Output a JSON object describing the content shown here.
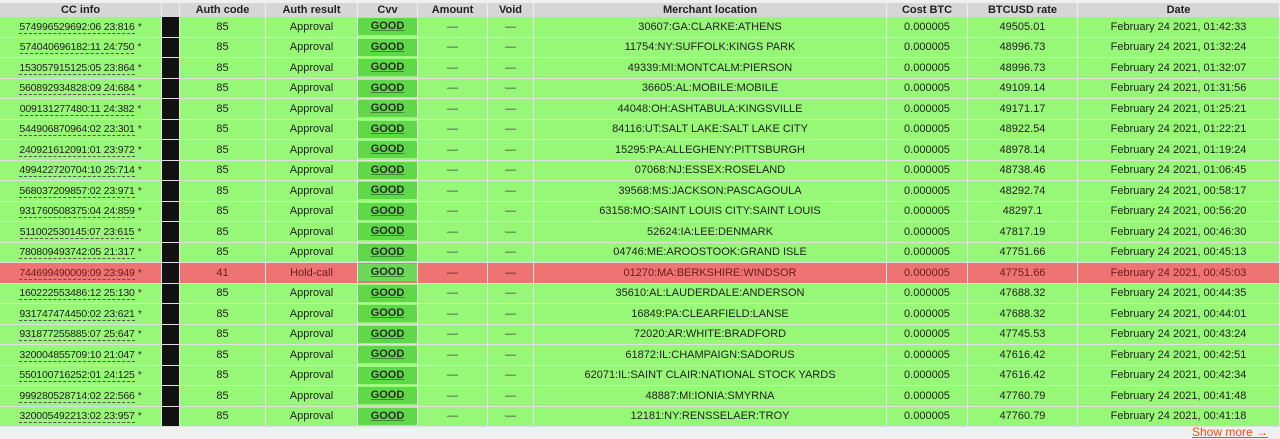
{
  "headers": [
    "CC info",
    "",
    "Auth code",
    "Auth result",
    "Cvv",
    "Amount",
    "Void",
    "Merchant location",
    "Cost BTC",
    "BTCUSD rate",
    "Date"
  ],
  "show_more": "Show more →",
  "colors": {
    "row_ok": "#97f776",
    "row_hold": "#ee7373",
    "cvv_good": "#5fd84a",
    "link": "#e8501e"
  },
  "rows": [
    {
      "cc": "574996529692:06 23:816",
      "auth_code": "85",
      "auth_result": "Approval",
      "cvv": "GOOD",
      "amount": "—",
      "void": "—",
      "location": "30607:GA:CLARKE:ATHENS",
      "cost_btc": "0.000005",
      "btcusd": "49505.01",
      "date": "February 24 2021, 01:42:33",
      "status": "ok"
    },
    {
      "cc": "574040696182:11 24:750",
      "auth_code": "85",
      "auth_result": "Approval",
      "cvv": "GOOD",
      "amount": "—",
      "void": "—",
      "location": "11754:NY:SUFFOLK:KINGS PARK",
      "cost_btc": "0.000005",
      "btcusd": "48996.73",
      "date": "February 24 2021, 01:32:24",
      "status": "ok"
    },
    {
      "cc": "153057915125:05 23:864",
      "auth_code": "85",
      "auth_result": "Approval",
      "cvv": "GOOD",
      "amount": "—",
      "void": "—",
      "location": "49339:MI:MONTCALM:PIERSON",
      "cost_btc": "0.000005",
      "btcusd": "48996.73",
      "date": "February 24 2021, 01:32:07",
      "status": "ok"
    },
    {
      "cc": "560892934828:09 24:684",
      "auth_code": "85",
      "auth_result": "Approval",
      "cvv": "GOOD",
      "amount": "—",
      "void": "—",
      "location": "36605:AL:MOBILE:MOBILE",
      "cost_btc": "0.000005",
      "btcusd": "49109.14",
      "date": "February 24 2021, 01:31:56",
      "status": "ok"
    },
    {
      "cc": "009131277480:11 24:382",
      "auth_code": "85",
      "auth_result": "Approval",
      "cvv": "GOOD",
      "amount": "—",
      "void": "—",
      "location": "44048:OH:ASHTABULA:KINGSVILLE",
      "cost_btc": "0.000005",
      "btcusd": "49171.17",
      "date": "February 24 2021, 01:25:21",
      "status": "ok"
    },
    {
      "cc": "544906870964:02 23:301",
      "auth_code": "85",
      "auth_result": "Approval",
      "cvv": "GOOD",
      "amount": "—",
      "void": "—",
      "location": "84116:UT:SALT LAKE:SALT LAKE CITY",
      "cost_btc": "0.000005",
      "btcusd": "48922.54",
      "date": "February 24 2021, 01:22:21",
      "status": "ok"
    },
    {
      "cc": "240921612091:01 23:972",
      "auth_code": "85",
      "auth_result": "Approval",
      "cvv": "GOOD",
      "amount": "—",
      "void": "—",
      "location": "15295:PA:ALLEGHENY:PITTSBURGH",
      "cost_btc": "0.000005",
      "btcusd": "48978.14",
      "date": "February 24 2021, 01:19:24",
      "status": "ok"
    },
    {
      "cc": "499422720704:10 25:714",
      "auth_code": "85",
      "auth_result": "Approval",
      "cvv": "GOOD",
      "amount": "—",
      "void": "—",
      "location": "07068:NJ:ESSEX:ROSELAND",
      "cost_btc": "0.000005",
      "btcusd": "48738.46",
      "date": "February 24 2021, 01:06:45",
      "status": "ok"
    },
    {
      "cc": "568037209857:02 23:971",
      "auth_code": "85",
      "auth_result": "Approval",
      "cvv": "GOOD",
      "amount": "—",
      "void": "—",
      "location": "39568:MS:JACKSON:PASCAGOULA",
      "cost_btc": "0.000005",
      "btcusd": "48292.74",
      "date": "February 24 2021, 00:58:17",
      "status": "ok"
    },
    {
      "cc": "931760508375:04 24:859",
      "auth_code": "85",
      "auth_result": "Approval",
      "cvv": "GOOD",
      "amount": "—",
      "void": "—",
      "location": "63158:MO:SAINT LOUIS CITY:SAINT LOUIS",
      "cost_btc": "0.000005",
      "btcusd": "48297.1",
      "date": "February 24 2021, 00:56:20",
      "status": "ok"
    },
    {
      "cc": "511002530145:07 23:615",
      "auth_code": "85",
      "auth_result": "Approval",
      "cvv": "GOOD",
      "amount": "—",
      "void": "—",
      "location": "52624:IA:LEE:DENMARK",
      "cost_btc": "0.000005",
      "btcusd": "47817.19",
      "date": "February 24 2021, 00:46:30",
      "status": "ok"
    },
    {
      "cc": "780809493742:05 21:317",
      "auth_code": "85",
      "auth_result": "Approval",
      "cvv": "GOOD",
      "amount": "—",
      "void": "—",
      "location": "04746:ME:AROOSTOOK:GRAND ISLE",
      "cost_btc": "0.000005",
      "btcusd": "47751.66",
      "date": "February 24 2021, 00:45:13",
      "status": "ok"
    },
    {
      "cc": "744699490009:09 23:949",
      "auth_code": "41",
      "auth_result": "Hold-call",
      "cvv": "GOOD",
      "amount": "—",
      "void": "—",
      "location": "01270:MA:BERKSHIRE:WINDSOR",
      "cost_btc": "0.000005",
      "btcusd": "47751.66",
      "date": "February 24 2021, 00:45:03",
      "status": "hold"
    },
    {
      "cc": "160222553486:12 25:130",
      "auth_code": "85",
      "auth_result": "Approval",
      "cvv": "GOOD",
      "amount": "—",
      "void": "—",
      "location": "35610:AL:LAUDERDALE:ANDERSON",
      "cost_btc": "0.000005",
      "btcusd": "47688.32",
      "date": "February 24 2021, 00:44:35",
      "status": "ok"
    },
    {
      "cc": "931747474450:02 23:621",
      "auth_code": "85",
      "auth_result": "Approval",
      "cvv": "GOOD",
      "amount": "—",
      "void": "—",
      "location": "16849:PA:CLEARFIELD:LANSE",
      "cost_btc": "0.000005",
      "btcusd": "47688.32",
      "date": "February 24 2021, 00:44:01",
      "status": "ok"
    },
    {
      "cc": "931877255885:07 25:647",
      "auth_code": "85",
      "auth_result": "Approval",
      "cvv": "GOOD",
      "amount": "—",
      "void": "—",
      "location": "72020:AR:WHITE:BRADFORD",
      "cost_btc": "0.000005",
      "btcusd": "47745.53",
      "date": "February 24 2021, 00:43:24",
      "status": "ok"
    },
    {
      "cc": "320004855709:10 21:047",
      "auth_code": "85",
      "auth_result": "Approval",
      "cvv": "GOOD",
      "amount": "—",
      "void": "—",
      "location": "61872:IL:CHAMPAIGN:SADORUS",
      "cost_btc": "0.000005",
      "btcusd": "47616.42",
      "date": "February 24 2021, 00:42:51",
      "status": "ok"
    },
    {
      "cc": "550100716252:01 24:125",
      "auth_code": "85",
      "auth_result": "Approval",
      "cvv": "GOOD",
      "amount": "—",
      "void": "—",
      "location": "62071:IL:SAINT CLAIR:NATIONAL STOCK YARDS",
      "cost_btc": "0.000005",
      "btcusd": "47616.42",
      "date": "February 24 2021, 00:42:34",
      "status": "ok"
    },
    {
      "cc": "999280528714:02 22:566",
      "auth_code": "85",
      "auth_result": "Approval",
      "cvv": "GOOD",
      "amount": "—",
      "void": "—",
      "location": "48887:MI:IONIA:SMYRNA",
      "cost_btc": "0.000005",
      "btcusd": "47760.79",
      "date": "February 24 2021, 00:41:48",
      "status": "ok"
    },
    {
      "cc": "320005492213:02 23:957",
      "auth_code": "85",
      "auth_result": "Approval",
      "cvv": "GOOD",
      "amount": "—",
      "void": "—",
      "location": "12181:NY:RENSSELAER:TROY",
      "cost_btc": "0.000005",
      "btcusd": "47760.79",
      "date": "February 24 2021, 00:41:18",
      "status": "ok"
    }
  ]
}
